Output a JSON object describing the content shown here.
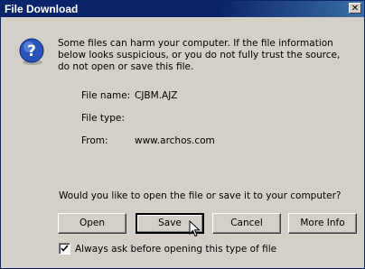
{
  "window": {
    "title": "File Download",
    "close_glyph": "✕"
  },
  "message": {
    "warning": "Some files can harm your computer. If the file information below looks suspicious, or you do not fully trust the source, do not open or save this file.",
    "icon": "question-icon"
  },
  "file_info": {
    "name_label": "File name:",
    "name_value": "CJBM.AJZ",
    "type_label": "File type:",
    "type_value": "",
    "from_label": "From:",
    "from_value": "www.archos.com"
  },
  "prompt": {
    "question": "Would you like to open the file or save it to your computer?"
  },
  "buttons": {
    "open": "Open",
    "save": "Save",
    "cancel": "Cancel",
    "more_info": "More Info"
  },
  "checkbox": {
    "label": "Always ask before opening this type of file",
    "checked": true
  },
  "colors": {
    "titlebar": "#0a246a",
    "dialog_bg": "#d4d0c8",
    "help_icon": "#2a55b8"
  }
}
